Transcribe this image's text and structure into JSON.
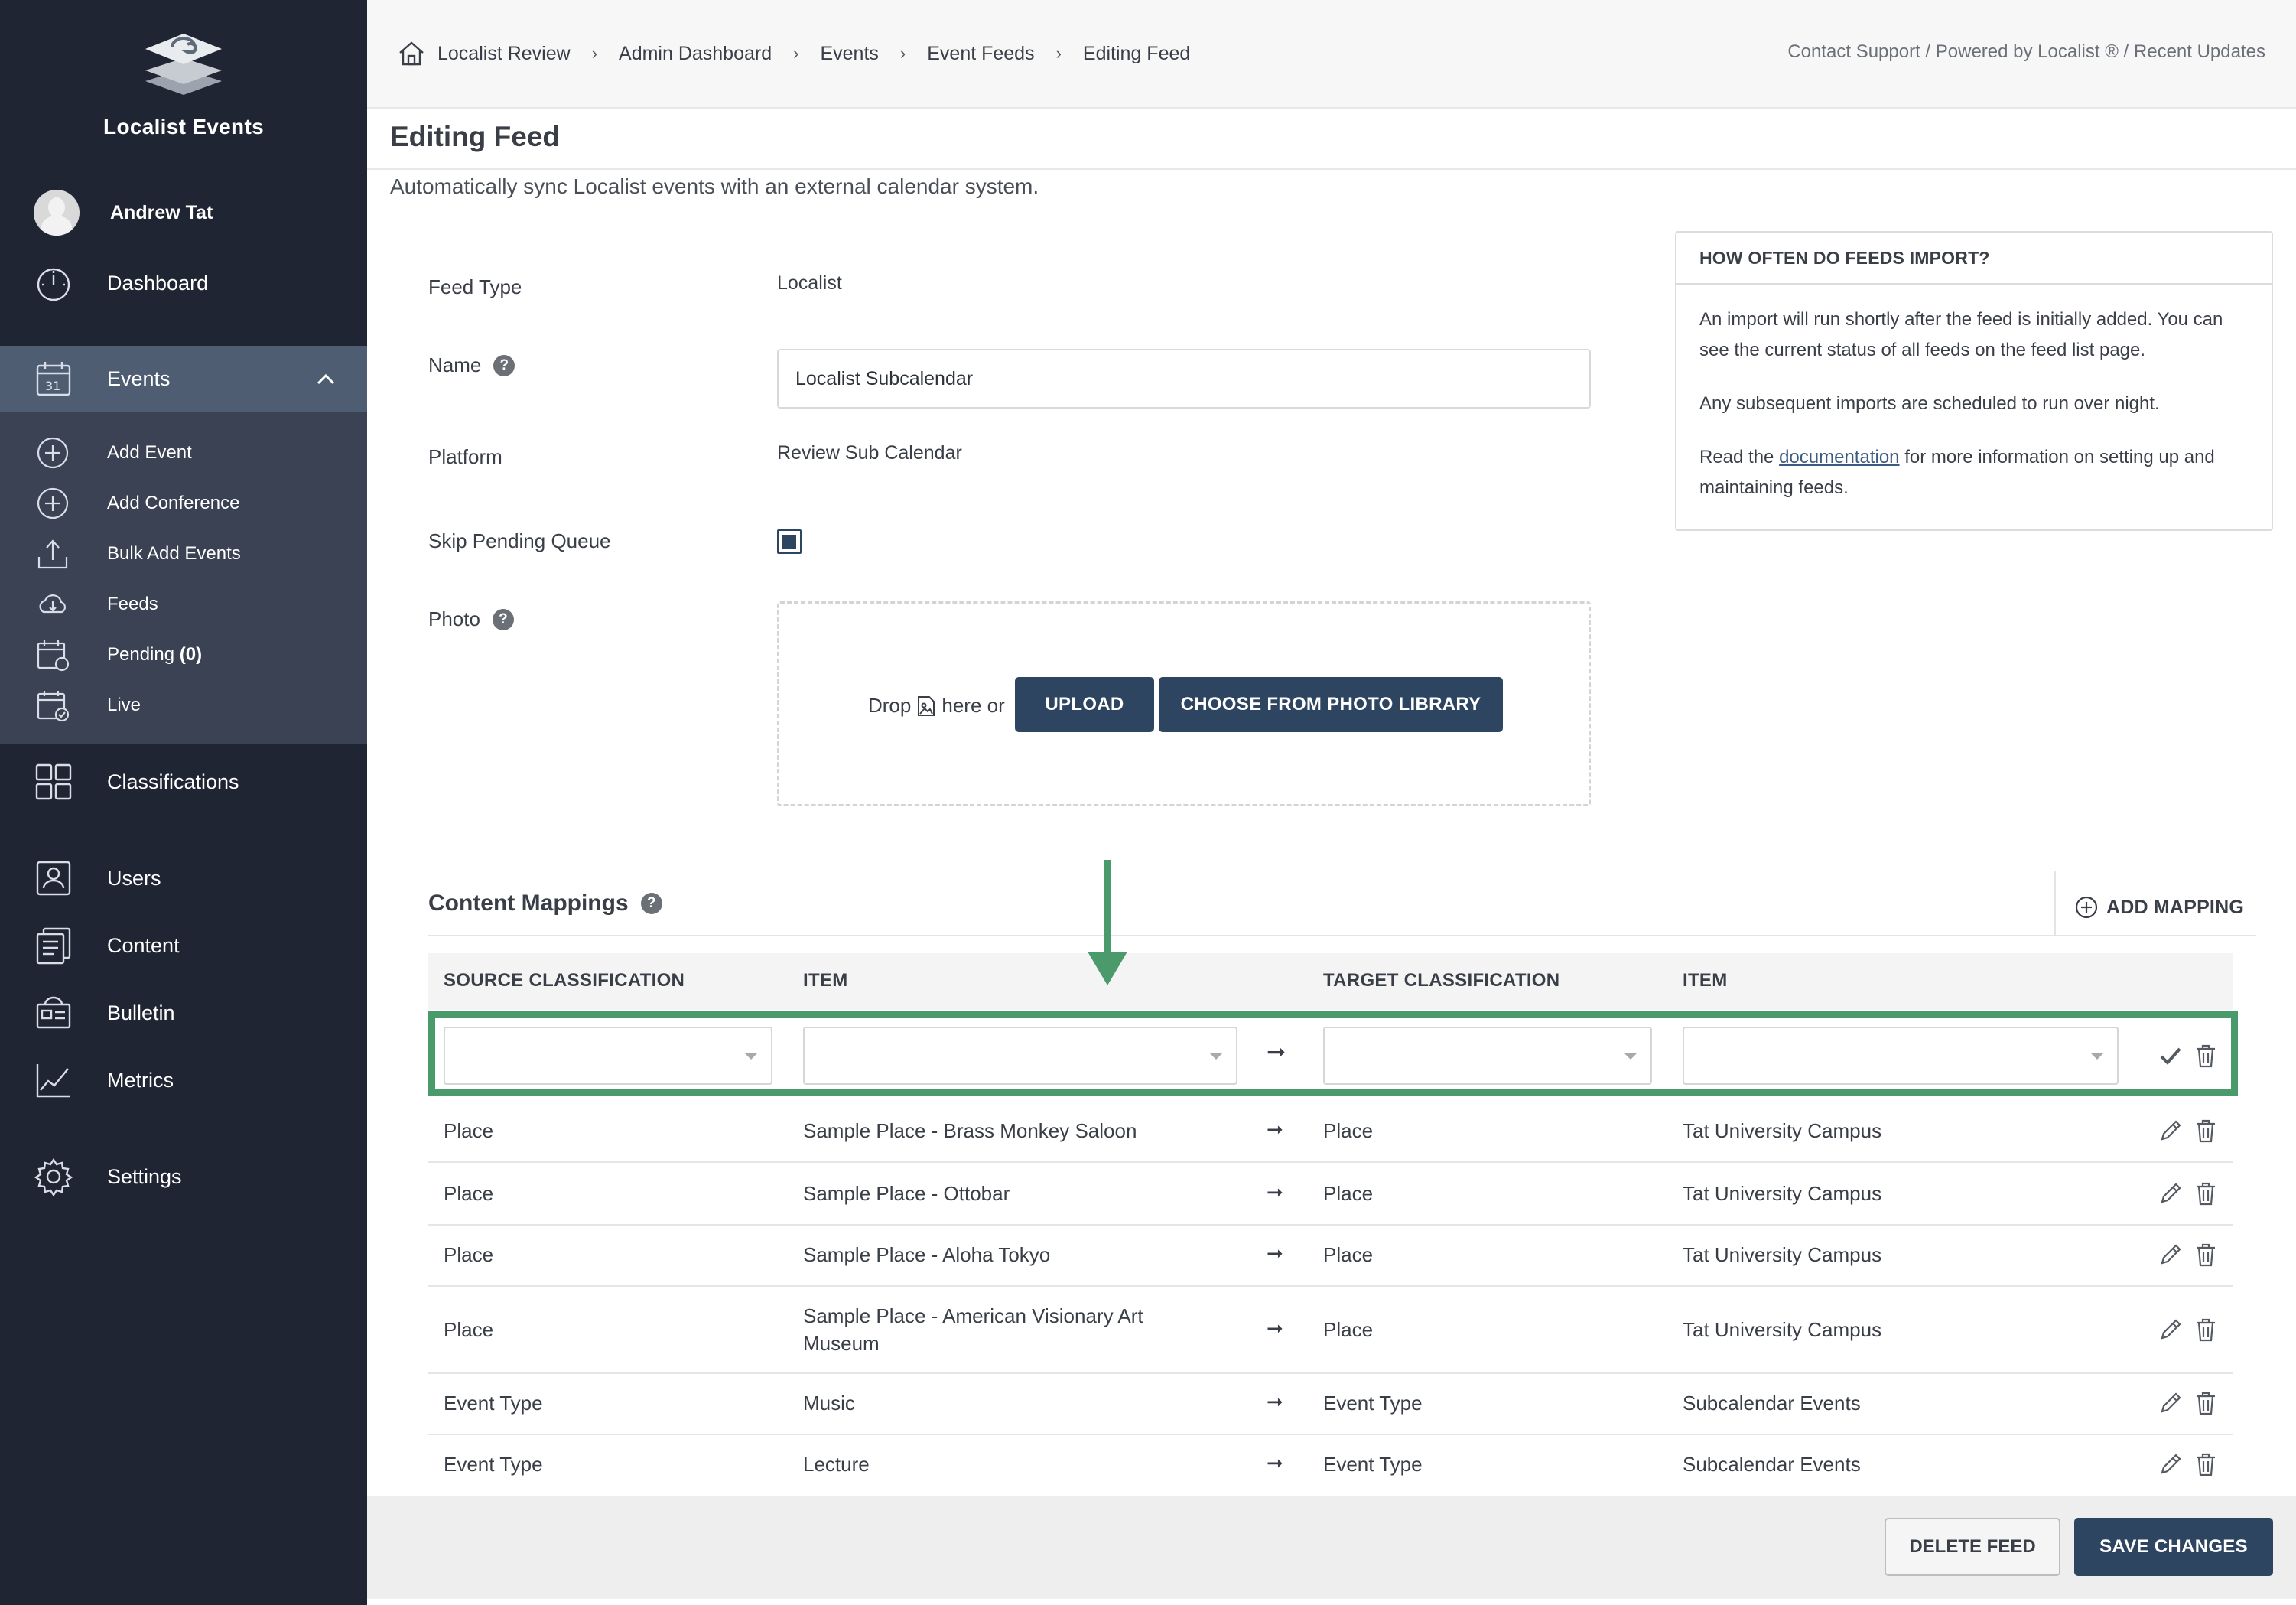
{
  "app": {
    "name": "Localist Events"
  },
  "colors": {
    "sidebar": "#1f2533",
    "sidebar_active": "#4f5d73",
    "sidebar_sub": "#3a4253",
    "primary": "#2e4562",
    "highlight": "#4a9a6b"
  },
  "sidebar": {
    "user": "Andrew Tat",
    "items": [
      {
        "label": "Dashboard",
        "icon": "gauge-icon"
      },
      {
        "label": "Events",
        "icon": "calendar-icon"
      },
      {
        "label": "Classifications",
        "icon": "grid-icon"
      },
      {
        "label": "Users",
        "icon": "user-icon"
      },
      {
        "label": "Content",
        "icon": "document-icon"
      },
      {
        "label": "Bulletin",
        "icon": "newspaper-icon"
      },
      {
        "label": "Metrics",
        "icon": "chart-icon"
      },
      {
        "label": "Settings",
        "icon": "gear-icon"
      }
    ],
    "event_sub": [
      {
        "label": "Add Event",
        "icon": "plus-circle-icon"
      },
      {
        "label": "Add Conference",
        "icon": "plus-circle-icon"
      },
      {
        "label": "Bulk Add Events",
        "icon": "upload-icon"
      },
      {
        "label": "Feeds",
        "icon": "cloud-icon"
      },
      {
        "label": "Pending",
        "count": "(0)",
        "icon": "calendar-clock-icon"
      },
      {
        "label": "Live",
        "icon": "calendar-check-icon"
      }
    ]
  },
  "breadcrumb": [
    "Localist Review",
    "Admin Dashboard",
    "Events",
    "Event Feeds",
    "Editing Feed"
  ],
  "top_links": "Contact Support / Powered by Localist ® / Recent Updates",
  "page": {
    "title": "Editing Feed",
    "subtitle": "Automatically sync Localist events with an external calendar system."
  },
  "form": {
    "feed_type_label": "Feed Type",
    "feed_type_value": "Localist",
    "name_label": "Name",
    "name_value": "Localist Subcalendar",
    "platform_label": "Platform",
    "platform_value": "Review Sub Calendar",
    "skip_label": "Skip Pending Queue",
    "skip_checked": true,
    "photo_label": "Photo",
    "drop_prefix": "Drop",
    "drop_suffix": "here or",
    "upload_label": "UPLOAD",
    "library_label": "CHOOSE FROM PHOTO LIBRARY",
    "help_mark": "?"
  },
  "info": {
    "title": "HOW OFTEN DO FEEDS IMPORT?",
    "p1": "An import will run shortly after the feed is initially added. You can see the current status of all feeds on the feed list page.",
    "p2": "Any subsequent imports are scheduled to run over night.",
    "p3_before": "Read the",
    "p3_link": "documentation",
    "p3_after": "for more information on setting up and maintaining feeds."
  },
  "mappings": {
    "title": "Content Mappings",
    "add_label": "ADD MAPPING",
    "headers": [
      "SOURCE CLASSIFICATION",
      "ITEM",
      "TARGET CLASSIFICATION",
      "ITEM"
    ],
    "arrow": "➞",
    "rows": [
      {
        "source": "Place",
        "item": "Sample Place - Brass Monkey Saloon",
        "target": "Place",
        "target_item": "Tat University Campus"
      },
      {
        "source": "Place",
        "item": "Sample Place - Ottobar",
        "target": "Place",
        "target_item": "Tat University Campus"
      },
      {
        "source": "Place",
        "item": "Sample Place - Aloha Tokyo",
        "target": "Place",
        "target_item": "Tat University Campus"
      },
      {
        "source": "Place",
        "item": "Sample Place - American Visionary Art Museum",
        "target": "Place",
        "target_item": "Tat University Campus"
      },
      {
        "source": "Event Type",
        "item": "Music",
        "target": "Event Type",
        "target_item": "Subcalendar Events"
      },
      {
        "source": "Event Type",
        "item": "Lecture",
        "target": "Event Type",
        "target_item": "Subcalendar Events"
      }
    ]
  },
  "footer": {
    "delete_label": "DELETE FEED",
    "save_label": "SAVE CHANGES"
  }
}
